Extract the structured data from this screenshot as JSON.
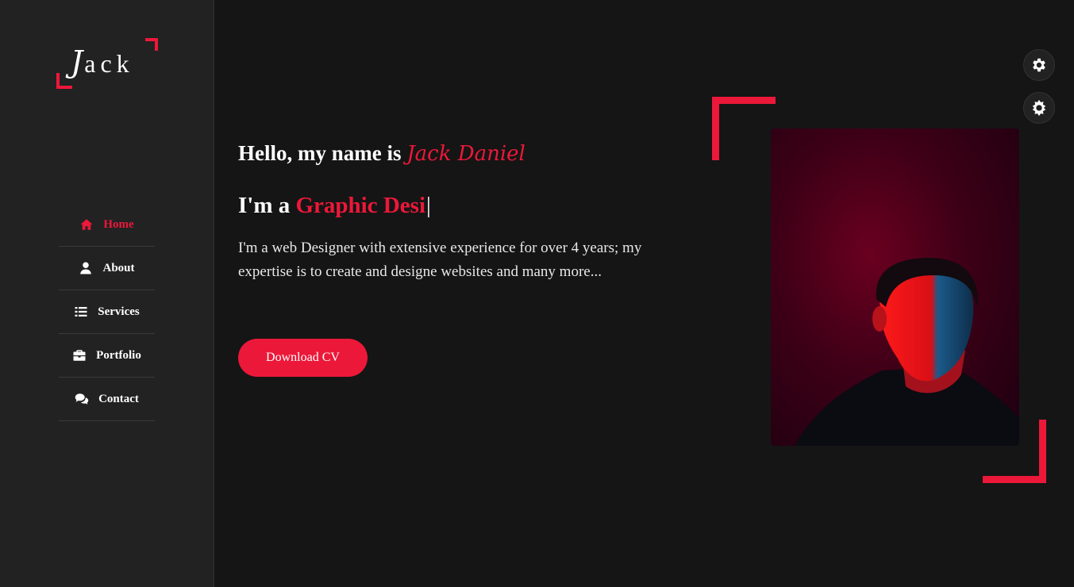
{
  "logo": {
    "first_letter": "J",
    "rest": "ack"
  },
  "nav": {
    "items": [
      {
        "label": "Home",
        "icon": "home-icon",
        "active": true
      },
      {
        "label": "About",
        "icon": "user-icon",
        "active": false
      },
      {
        "label": "Services",
        "icon": "list-icon",
        "active": false
      },
      {
        "label": "Portfolio",
        "icon": "briefcase-icon",
        "active": false
      },
      {
        "label": "Contact",
        "icon": "comments-icon",
        "active": false
      }
    ]
  },
  "hero": {
    "greeting": "Hello, my name is",
    "name": "Jack Daniel",
    "role_prefix": "I'm a",
    "role_typed": "Graphic Desi",
    "description": "I'm a web Designer with extensive experience for over 4 years; my expertise is to create and designe websites and many more...",
    "button_label": "Download CV"
  },
  "settings": {
    "style_switcher_icon": "gear-icon",
    "theme_toggle_icon": "sun-icon"
  },
  "colors": {
    "accent": "#ec1839",
    "background": "#151515",
    "sidebar": "#222222"
  }
}
